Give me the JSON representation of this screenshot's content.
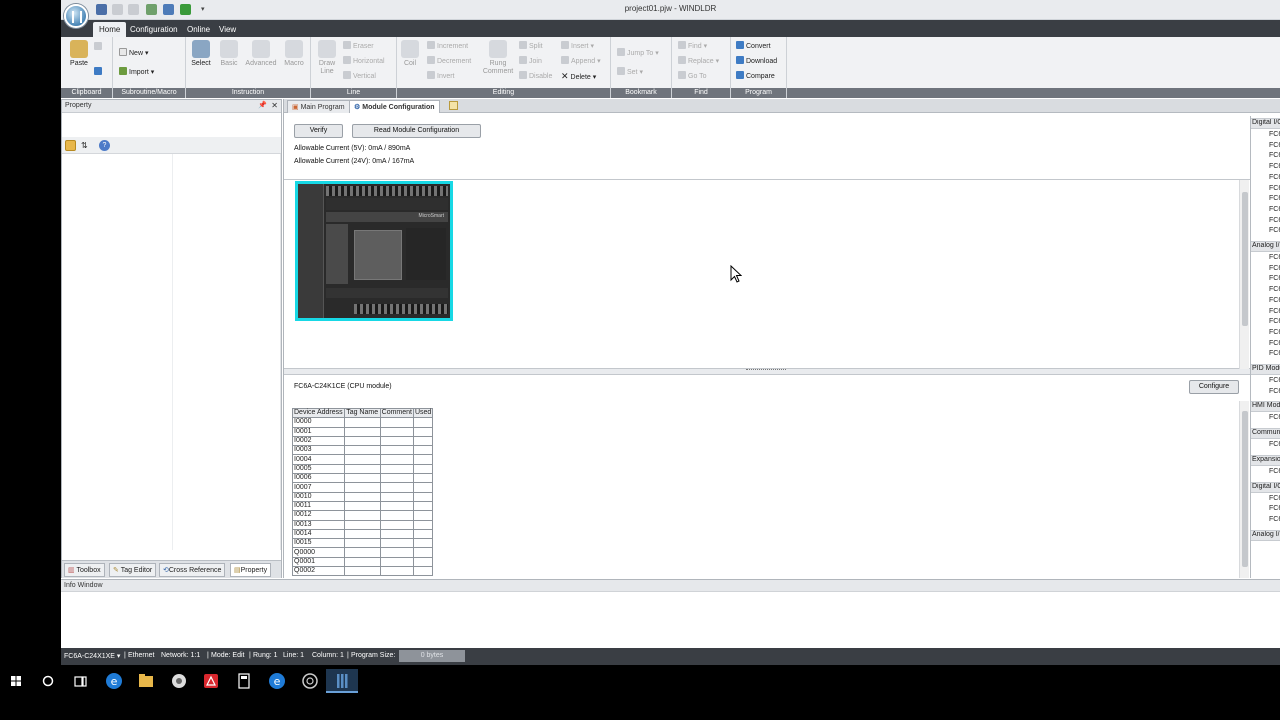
{
  "window": {
    "title": "project01.pjw - WINDLDR"
  },
  "quick_access": [
    "save-icon",
    "undo-icon",
    "redo-icon",
    "print-icon",
    "monitor-icon",
    "download-icon",
    "customize-icon"
  ],
  "menu": {
    "tabs": [
      "Home",
      "Configuration",
      "Online",
      "View"
    ],
    "active": "Home"
  },
  "ribbon": {
    "clipboard": {
      "label": "Clipboard",
      "paste": "Paste"
    },
    "subroutine": {
      "label": "Subroutine/Macro",
      "new": "New",
      "import": "Import"
    },
    "instruction": {
      "label": "Instruction",
      "select": "Select",
      "basic": "Basic",
      "advanced": "Advanced",
      "macro": "Macro"
    },
    "line": {
      "label": "Line",
      "draw_line": "Draw Line",
      "eraser": "Eraser",
      "horizontal": "Horizontal",
      "vertical": "Vertical"
    },
    "editing": {
      "label": "Editing",
      "coil": "Coil",
      "increment": "Increment",
      "decrement": "Decrement",
      "invert": "Invert",
      "rung_comment": "Rung Comment",
      "split": "Split",
      "join": "Join",
      "disable": "Disable",
      "insert": "Insert",
      "append": "Append",
      "delete": "Delete"
    },
    "bookmark": {
      "label": "Bookmark",
      "jump_to": "Jump To",
      "set": "Set"
    },
    "find": {
      "label": "Find",
      "find": "Find",
      "replace": "Replace",
      "go_to": "Go To"
    },
    "program": {
      "label": "Program",
      "convert": "Convert",
      "download": "Download",
      "compare": "Compare"
    }
  },
  "property_pane": {
    "title": "Property",
    "tabs": [
      "Toolbox",
      "Tag Editor",
      "Cross Reference",
      "Property"
    ],
    "active_tab": "Property"
  },
  "doc_tabs": {
    "main_program": "Main Program",
    "module_configuration": "Module Configuration"
  },
  "module_config": {
    "verify": "Verify",
    "read_module_configuration": "Read Module Configuration",
    "allowable_5v": "Allowable Current (5V): 0mA / 890mA",
    "allowable_24v": "Allowable Current (24V): 0mA / 167mA",
    "module_title": "FC6A-C24K1CE (CPU module)",
    "configure": "Configure",
    "plc_brand": "MicroSmart",
    "table": {
      "headers": [
        "Device Address",
        "Tag Name",
        "Comment",
        "Used"
      ],
      "rows": [
        "I0000",
        "I0001",
        "I0002",
        "I0003",
        "I0004",
        "I0005",
        "I0006",
        "I0007",
        "I0010",
        "I0011",
        "I0012",
        "I0013",
        "I0014",
        "I0015",
        "Q0000",
        "Q0001",
        "Q0002"
      ]
    }
  },
  "catalog": {
    "sections": [
      {
        "title": "Digital I/O",
        "items": [
          "FC6",
          "FC6",
          "FC6",
          "FC6",
          "FC6",
          "FC6",
          "FC6",
          "FC6",
          "FC6",
          "FC6"
        ]
      },
      {
        "title": "Analog I/O",
        "items": [
          "FC6",
          "FC6",
          "FC6",
          "FC6",
          "FC6",
          "FC6",
          "FC6",
          "FC6",
          "FC6",
          "FC6"
        ]
      },
      {
        "title": "PID Module",
        "items": [
          "FC6",
          "FC6"
        ]
      },
      {
        "title": "HMI Module",
        "items": [
          "FC6"
        ]
      },
      {
        "title": "Communication",
        "items": [
          "FC6"
        ]
      },
      {
        "title": "Expansion",
        "items": [
          "FC6"
        ]
      },
      {
        "title": "Digital I/O",
        "items": [
          "FC6",
          "FC6",
          "FC6"
        ]
      },
      {
        "title": "Analog I/O",
        "items": []
      }
    ]
  },
  "info_window": {
    "title": "Info Window"
  },
  "status_bar": {
    "plc_type": "FC6A-C24X1XE",
    "connection": "Ethernet",
    "network": "Network: 1:1",
    "mode": "Mode: Edit",
    "rung": "Rung: 1",
    "line": "Line: 1",
    "column": "Column: 1",
    "program_size_label": "Program Size:",
    "program_size": "0 bytes"
  },
  "taskbar": {
    "icons": [
      "windows-start-icon",
      "search-circle-icon",
      "task-view-icon",
      "edge-icon",
      "file-explorer-icon",
      "tool-icon",
      "acrobat-icon",
      "calculator-icon",
      "edge-icon",
      "browser-icon",
      "windldr-icon"
    ],
    "active": "windldr-icon",
    "colors": {
      "edge": "#1f7bd6",
      "folder": "#e8b74a",
      "acrobat": "#d9272e",
      "windldr": "#5a8fc5"
    }
  }
}
